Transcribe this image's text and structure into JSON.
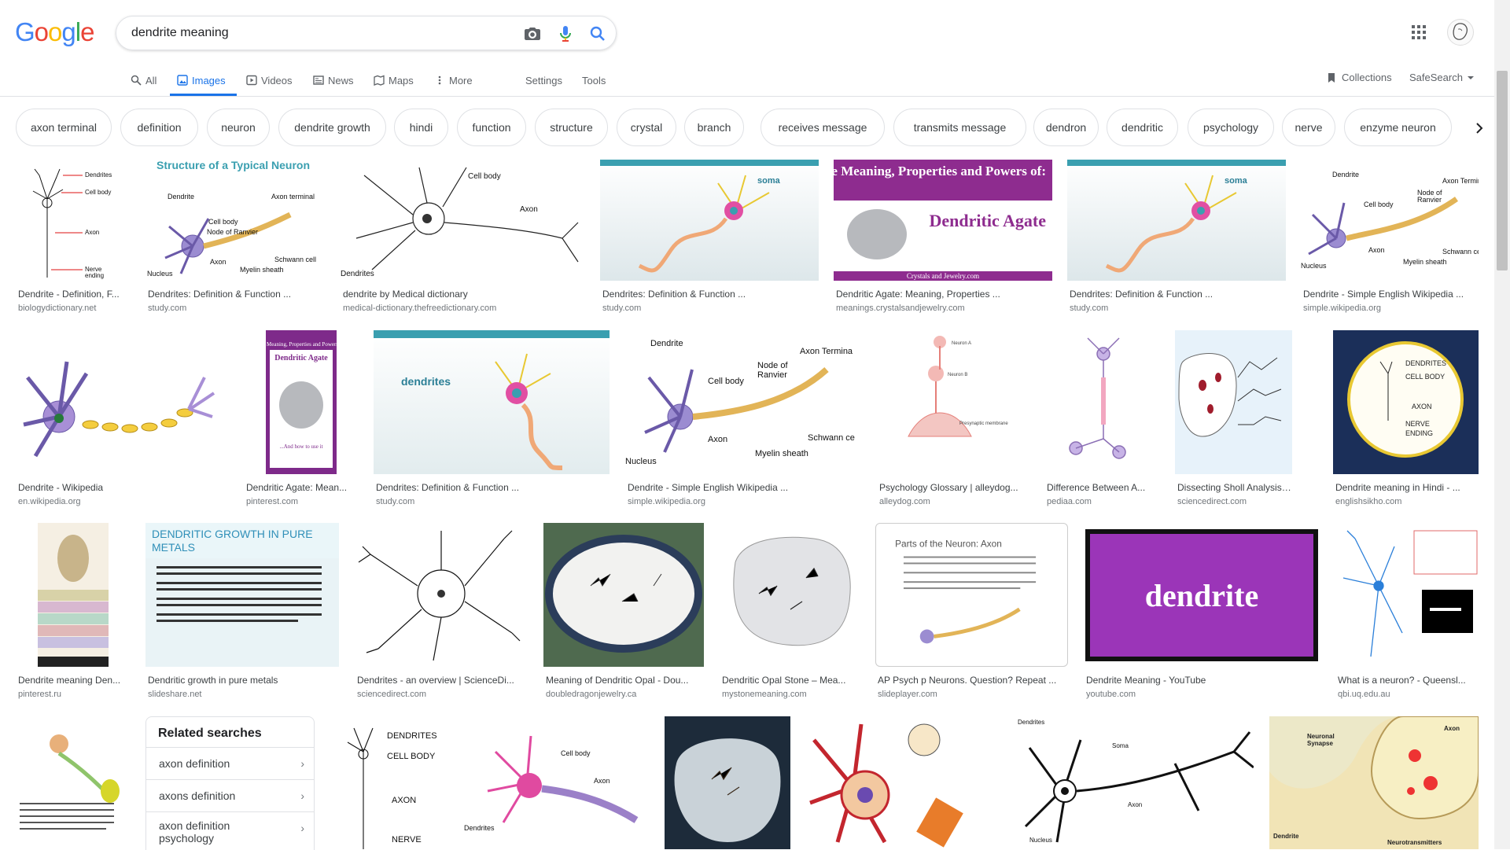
{
  "search": {
    "query": "dendrite meaning"
  },
  "tabs": {
    "all": "All",
    "images": "Images",
    "videos": "Videos",
    "news": "News",
    "maps": "Maps",
    "more": "More",
    "settings": "Settings",
    "tools": "Tools",
    "collections": "Collections",
    "safesearch": "SafeSearch"
  },
  "chips": [
    "axon terminal",
    "definition",
    "neuron",
    "dendrite growth",
    "hindi",
    "function",
    "structure",
    "crystal",
    "branch",
    "receives message",
    "transmits message",
    "dendron",
    "dendritic",
    "psychology",
    "nerve",
    "enzyme neuron"
  ],
  "results": {
    "row1": [
      {
        "title": "Dendrite - Definition, F...",
        "source": "biologydictionary.net"
      },
      {
        "title": "Dendrites: Definition & Function ...",
        "source": "study.com",
        "caption": "Structure of a Typical Neuron"
      },
      {
        "title": "dendrite by Medical dictionary",
        "source": "medical-dictionary.thefreedictionary.com"
      },
      {
        "title": "Dendrites: Definition & Function ...",
        "source": "study.com"
      },
      {
        "title": "Dendritic Agate: Meaning, Properties ...",
        "source": "meanings.crystalsandjewelry.com",
        "caption1": "The Meaning, Properties and Powers of:",
        "caption2": "Dendritic Agate",
        "caption3": "Crystals and Jewelry.com"
      },
      {
        "title": "Dendrites: Definition & Function ...",
        "source": "study.com"
      },
      {
        "title": "Dendrite - Simple English Wikipedia ...",
        "source": "simple.wikipedia.org"
      }
    ],
    "row2": [
      {
        "title": "Dendrite - Wikipedia",
        "source": "en.wikipedia.org"
      },
      {
        "title": "Dendritic Agate: Mean...",
        "source": "pinterest.com"
      },
      {
        "title": "Dendrites: Definition & Function ...",
        "source": "study.com",
        "caption": "dendrites"
      },
      {
        "title": "Dendrite - Simple English Wikipedia ...",
        "source": "simple.wikipedia.org"
      },
      {
        "title": "Psychology Glossary | alleydog...",
        "source": "alleydog.com"
      },
      {
        "title": "Difference Between A...",
        "source": "pediaa.com"
      },
      {
        "title": "Dissecting Sholl Analysis into...",
        "source": "sciencedirect.com"
      },
      {
        "title": "Dendrite meaning in Hindi - ...",
        "source": "englishsikho.com"
      }
    ],
    "row3": [
      {
        "title": "Dendrite meaning Den...",
        "source": "pinterest.ru"
      },
      {
        "title": "Dendritic growth in pure metals",
        "source": "slideshare.net",
        "caption": "DENDRITIC GROWTH IN PURE METALS"
      },
      {
        "title": "Dendrites - an overview | ScienceDi...",
        "source": "sciencedirect.com"
      },
      {
        "title": "Meaning of Dendritic Opal - Dou...",
        "source": "doubledragonjewelry.ca"
      },
      {
        "title": "Dendritic Opal Stone – Mea...",
        "source": "mystonemeaning.com"
      },
      {
        "title": "AP Psych p Neurons. Question? Repeat ...",
        "source": "slideplayer.com",
        "caption": "Parts of the Neuron: Axon"
      },
      {
        "title": "Dendrite Meaning - YouTube",
        "source": "youtube.com",
        "caption": "dendrite"
      },
      {
        "title": "What is a neuron? - Queensl...",
        "source": "qbi.uq.edu.au"
      }
    ]
  },
  "related": {
    "heading": "Related searches",
    "items": [
      "axon definition",
      "axons definition",
      "axon definition psychology"
    ]
  },
  "colors": {
    "accent": "#1a73e8",
    "purple": "#8e2c8f",
    "teal": "#3a9fb0"
  }
}
